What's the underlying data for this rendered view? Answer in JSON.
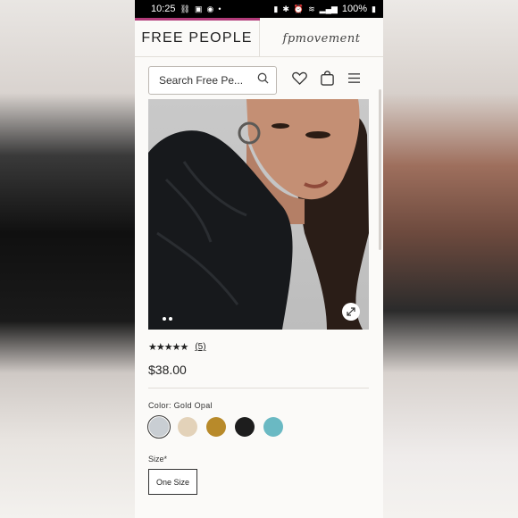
{
  "status_bar": {
    "time": "10:25",
    "battery": "100%"
  },
  "header": {
    "brand": "FREE PEOPLE",
    "sub_brand": "fpmovement"
  },
  "search": {
    "placeholder": "Search Free Pe..."
  },
  "nav": {
    "icons": [
      "heart-icon",
      "bag-icon",
      "menu-icon"
    ]
  },
  "product": {
    "rating_stars": "★★★★★",
    "review_count": "(5)",
    "price": "$38.00",
    "color_label": "Color: Gold Opal",
    "swatches": [
      {
        "name": "gold-opal",
        "color": "#c9ced3"
      },
      {
        "name": "cream",
        "color": "#e3d2b9"
      },
      {
        "name": "gold",
        "color": "#b88a2a"
      },
      {
        "name": "black",
        "color": "#1d1d1d"
      },
      {
        "name": "turquoise",
        "color": "#6ab9c3"
      }
    ],
    "size_label": "Size*",
    "size_option": "One Size"
  },
  "colors": {
    "accent": "#b23c7a",
    "background": "#fbfaf8"
  }
}
